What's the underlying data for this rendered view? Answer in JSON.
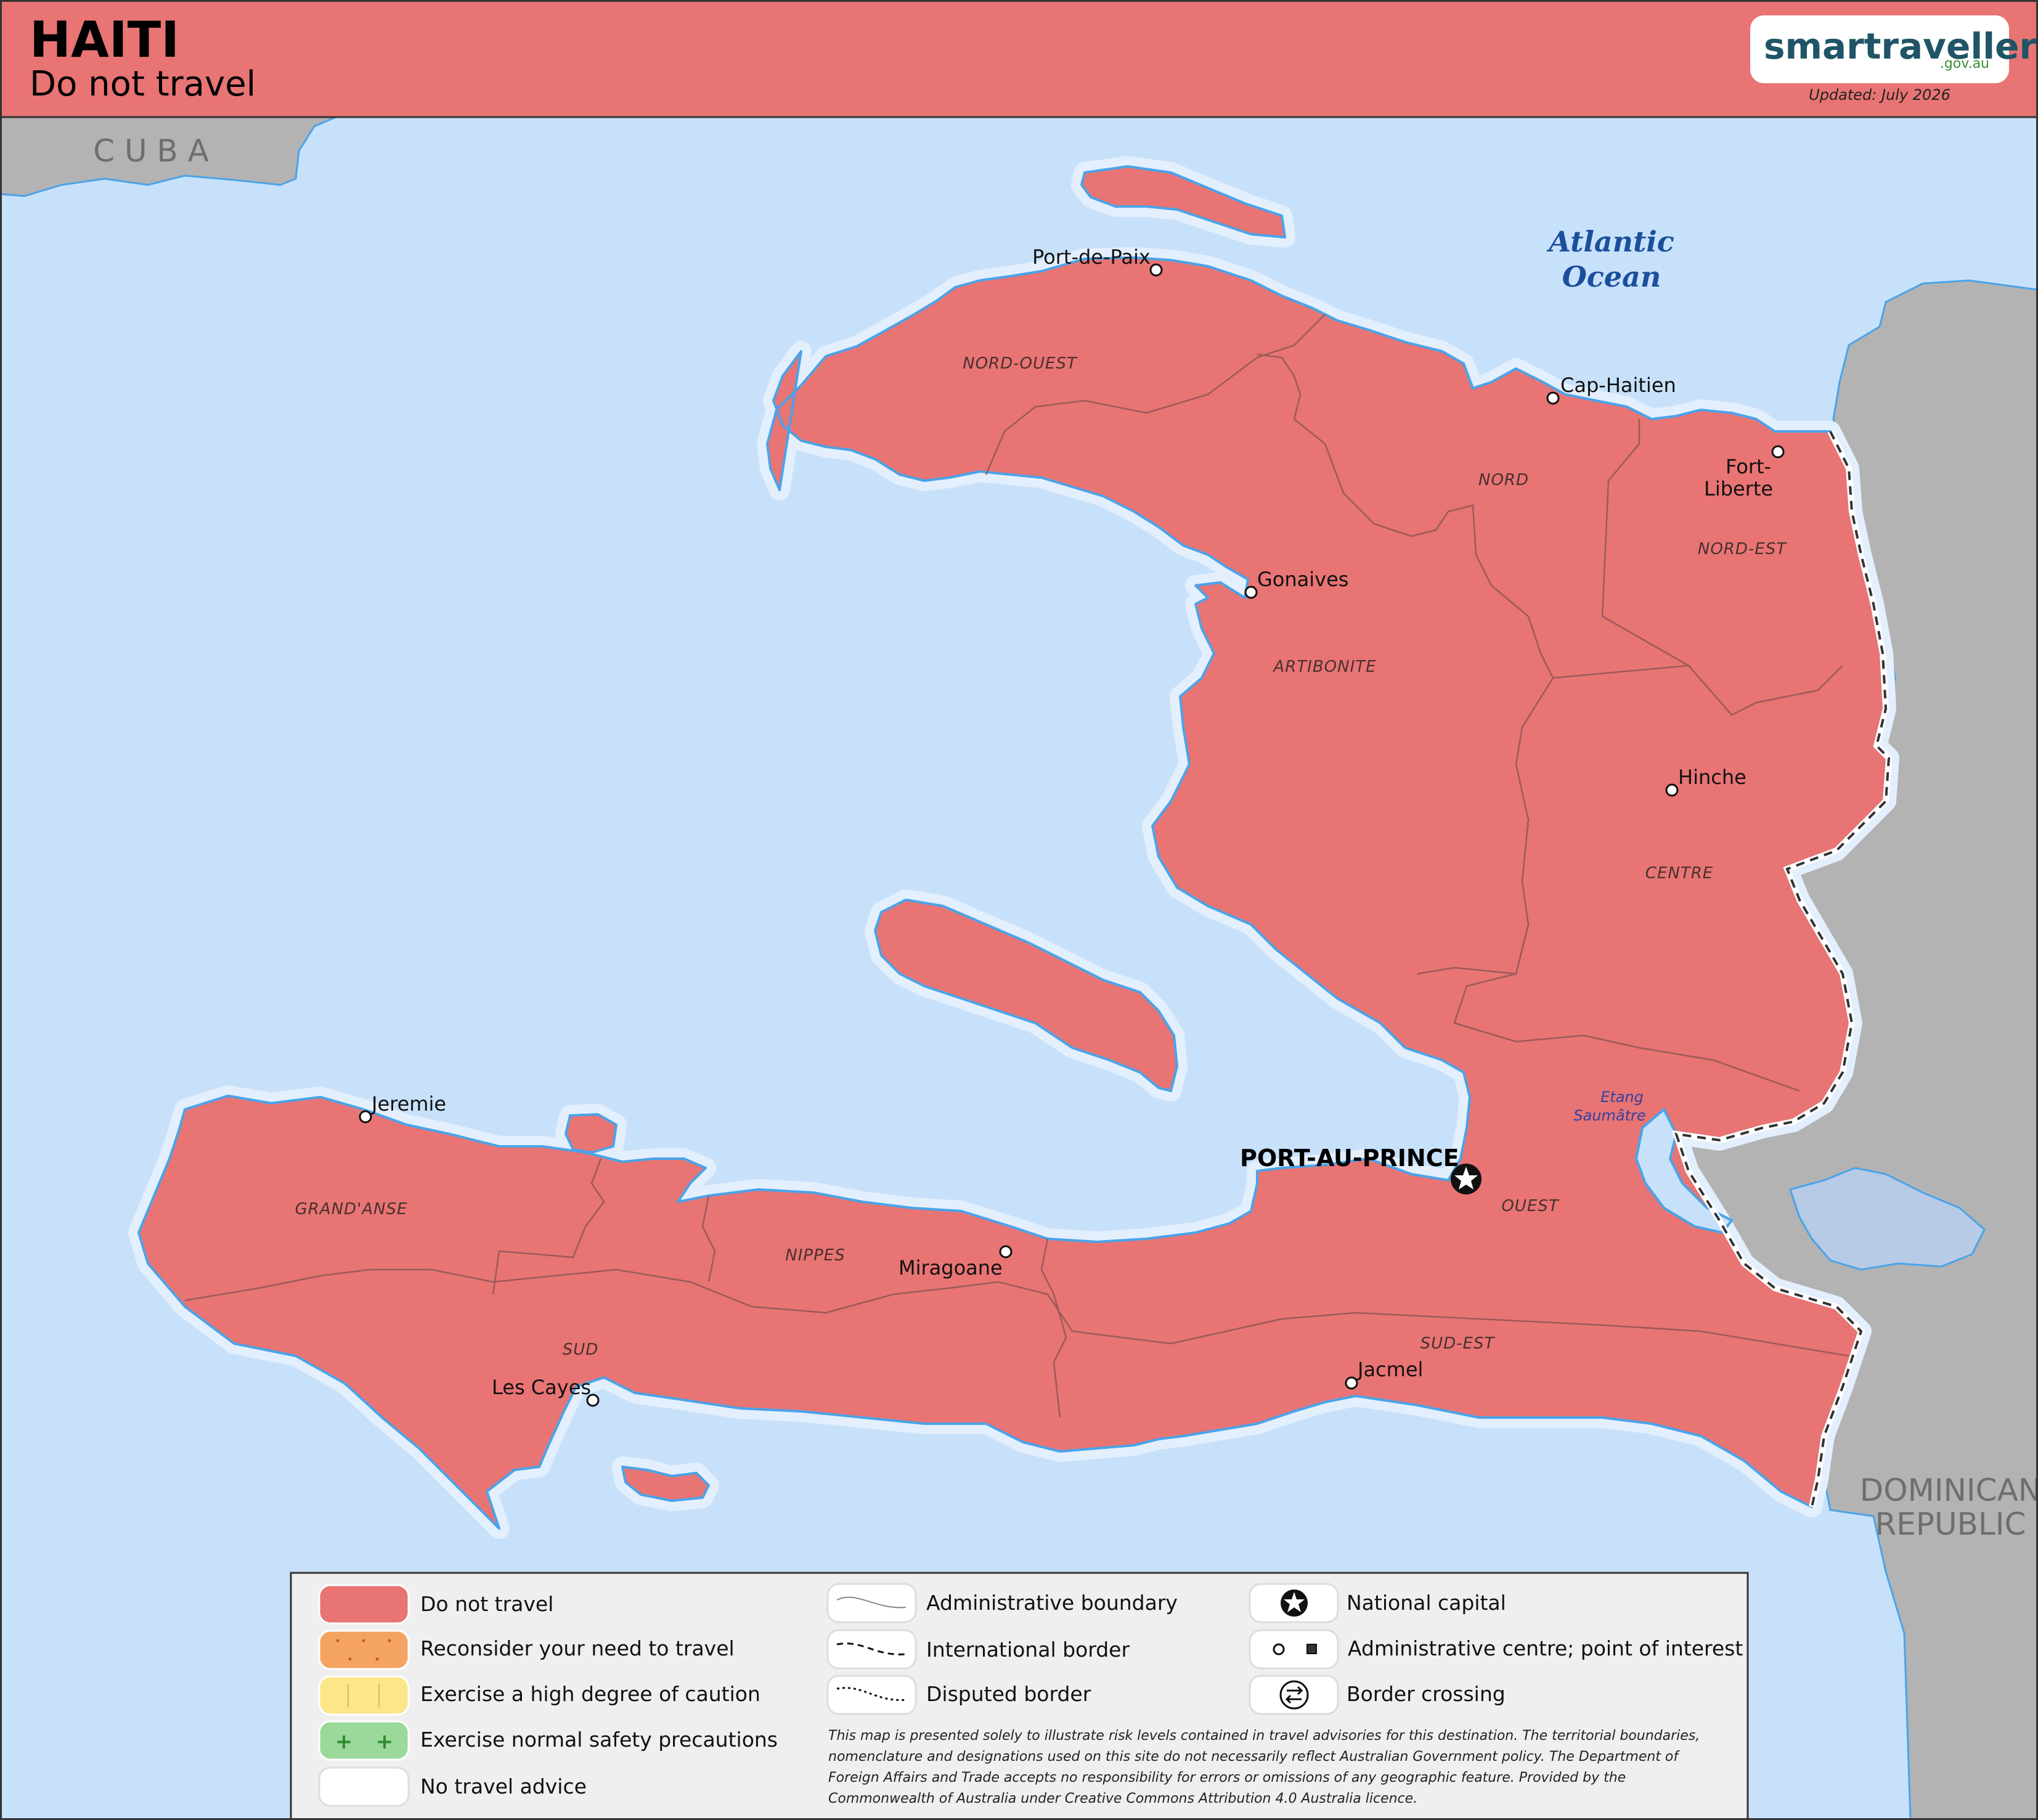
{
  "header": {
    "title": "HAITI",
    "subtitle": "Do not travel",
    "logo_main": "smartraveller",
    "logo_sub": ".gov.au",
    "updated": "Updated: July 2026"
  },
  "colors": {
    "do_not_travel": "#e87474",
    "reconsider": "#f4a460",
    "high_caution": "#fde68a",
    "normal": "#9ad99a",
    "no_advice": "#ffffff",
    "water": "#c8e1fb",
    "neighbour_land": "#b3b3b3",
    "coast_outline": "#4aa3e8",
    "logo_teal": "#1f5566",
    "logo_green": "#3a8f3a"
  },
  "labels": {
    "countries": {
      "cuba": "C U B A",
      "dominican_line1": "DOMINICAN",
      "dominican_line2": "REPUBLIC"
    },
    "ocean_line1": "Atlantic",
    "ocean_line2": "Ocean",
    "lake_line1": "Etang",
    "lake_line2": "Saumâtre",
    "regions": {
      "nord_ouest": "NORD-OUEST",
      "nord": "NORD",
      "nord_est": "NORD-EST",
      "artibonite": "ARTIBONITE",
      "centre": "CENTRE",
      "ouest": "OUEST",
      "sud_est": "SUD-EST",
      "nippes": "NIPPES",
      "sud": "SUD",
      "grandanse": "GRAND'ANSE"
    },
    "cities": {
      "port_de_paix": "Port-de-Paix",
      "cap_haitien": "Cap-Haitien",
      "fort_liberte_1": "Fort-",
      "fort_liberte_2": "Liberte",
      "gonaives": "Gonaives",
      "hinche": "Hinche",
      "jeremie": "Jeremie",
      "miragoane": "Miragoane",
      "les_cayes": "Les Cayes",
      "jacmel": "Jacmel"
    },
    "capital": "PORT-AU-PRINCE"
  },
  "legend": {
    "risk_levels": [
      {
        "label": "Do not travel",
        "color": "#e87474"
      },
      {
        "label": "Reconsider your need to travel",
        "color": "#f4a460"
      },
      {
        "label": "Exercise a high degree of caution",
        "color": "#fde68a"
      },
      {
        "label": "Exercise normal safety precautions",
        "color": "#9ad99a"
      },
      {
        "label": "No travel advice",
        "color": "#ffffff"
      }
    ],
    "lines": [
      {
        "label": "Administrative boundary",
        "icon": "admin-boundary-icon"
      },
      {
        "label": "International border",
        "icon": "international-border-icon"
      },
      {
        "label": "Disputed border",
        "icon": "disputed-border-icon"
      }
    ],
    "points": [
      {
        "label": "National capital",
        "icon": "star-icon"
      },
      {
        "label": "Administrative centre; point of interest",
        "icon": "circle-square-icon"
      },
      {
        "label": "Border crossing",
        "icon": "arrows-icon"
      }
    ],
    "disclaimer": [
      "This map is presented solely to illustrate risk levels contained in travel advisories for this destination. The territorial boundaries,",
      "nomenclature and designations used on this site do not necessarily reflect Australian Government policy. The Department of",
      "Foreign Affairs and Trade accepts no responsibility for errors or omissions of any geographic feature. Provided by the",
      "Commonwealth of Australia under Creative Commons Attribution 4.0 Australia licence."
    ]
  }
}
